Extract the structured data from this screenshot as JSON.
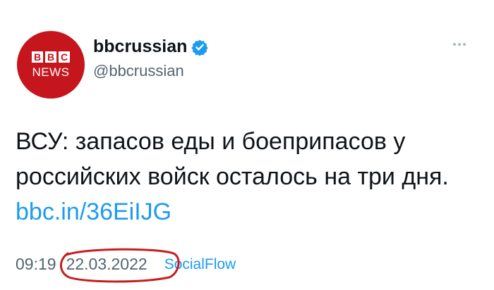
{
  "account": {
    "display_name": "bbcrussian",
    "handle": "@bbcrussian",
    "avatar_letters": [
      "B",
      "B",
      "C"
    ],
    "avatar_caption": "NEWS",
    "brand_color": "#c4161c",
    "verified_color": "#1d9bf0"
  },
  "tweet": {
    "text": "ВСУ: запасов еды и боеприпасов у российских войск осталось на три дня.",
    "link_text": "bbc.in/36EiIJG"
  },
  "meta": {
    "time": "09:19",
    "date": "22.03.2022",
    "source": "SocialFlow",
    "annotation_color": "#c81e1e"
  },
  "icons": {
    "verified": "verified-badge-icon",
    "more": "more-options-icon"
  }
}
